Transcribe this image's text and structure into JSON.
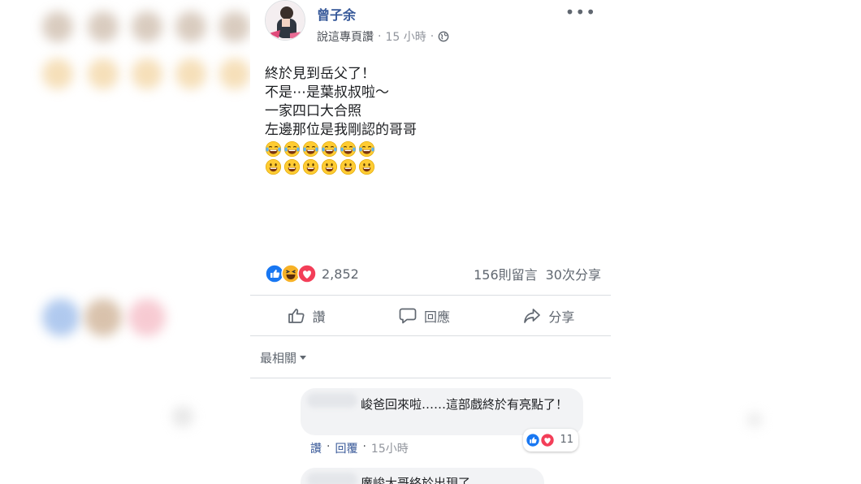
{
  "post": {
    "author": "曾子余",
    "page_name": "說這專頁讚",
    "separator": "·",
    "time": "15 小時",
    "more_label": "•••",
    "icons": {
      "privacy": "globe-icon",
      "more": "more-options-icon"
    },
    "body_lines": [
      "終於見到岳父了！",
      "不是⋯是葉叔叔啦～",
      "一家四口大合照",
      "左邊那位是我剛認的哥哥"
    ],
    "emoji_rows": [
      [
        "laughing-tears",
        "laughing-tears",
        "laughing-tears",
        "laughing-tears",
        "laughing-tears",
        "laughing-tears"
      ],
      [
        "grinning",
        "grinning",
        "grinning",
        "grinning",
        "grinning",
        "grinning"
      ]
    ]
  },
  "reactions": {
    "types": [
      "like",
      "haha",
      "love"
    ],
    "count": "2,852",
    "comments": "156則留言",
    "shares": "30次分享"
  },
  "actions": {
    "like": "讚",
    "comment": "回應",
    "share": "分享"
  },
  "sort": {
    "label": "最相關"
  },
  "comments": [
    {
      "text": "峻爸回來啦……這部戲終於有亮點了！",
      "like_label": "讚",
      "reply_label": "回覆",
      "separator": "·",
      "time": "15小時",
      "reaction_types": [
        "like",
        "love"
      ],
      "reaction_count": "11"
    },
    {
      "text": "廣峻大哥終於出現了"
    }
  ],
  "colors": {
    "author": "#365899",
    "link": "#385898",
    "like_blue": "#1877f2",
    "love_red": "#f33e58",
    "haha_yellow": "#f7b125",
    "divider": "#dadde1"
  }
}
